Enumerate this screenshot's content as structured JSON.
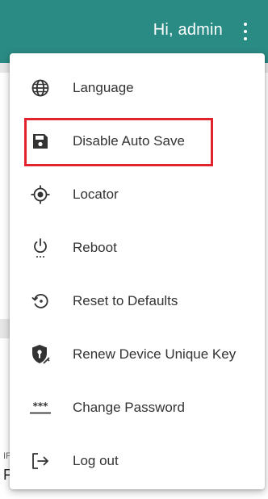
{
  "header": {
    "greeting": "Hi, admin",
    "background_color": "#2a8b84",
    "more_icon": "more-vertical-icon"
  },
  "background": {
    "fragment_1": "IF",
    "fragment_2": "F"
  },
  "menu": {
    "items": [
      {
        "label": "Language",
        "icon": "globe-icon"
      },
      {
        "label": "Disable Auto Save",
        "icon": "floppy-disk-icon"
      },
      {
        "label": "Locator",
        "icon": "crosshair-target-icon"
      },
      {
        "label": "Reboot",
        "icon": "power-icon"
      },
      {
        "label": "Reset to Defaults",
        "icon": "restore-icon"
      },
      {
        "label": "Renew Device Unique Key",
        "icon": "shield-key-icon"
      },
      {
        "label": "Change Password",
        "icon": "password-icon"
      },
      {
        "label": "Log out",
        "icon": "logout-icon"
      }
    ],
    "highlight_color": "#e0232d"
  }
}
